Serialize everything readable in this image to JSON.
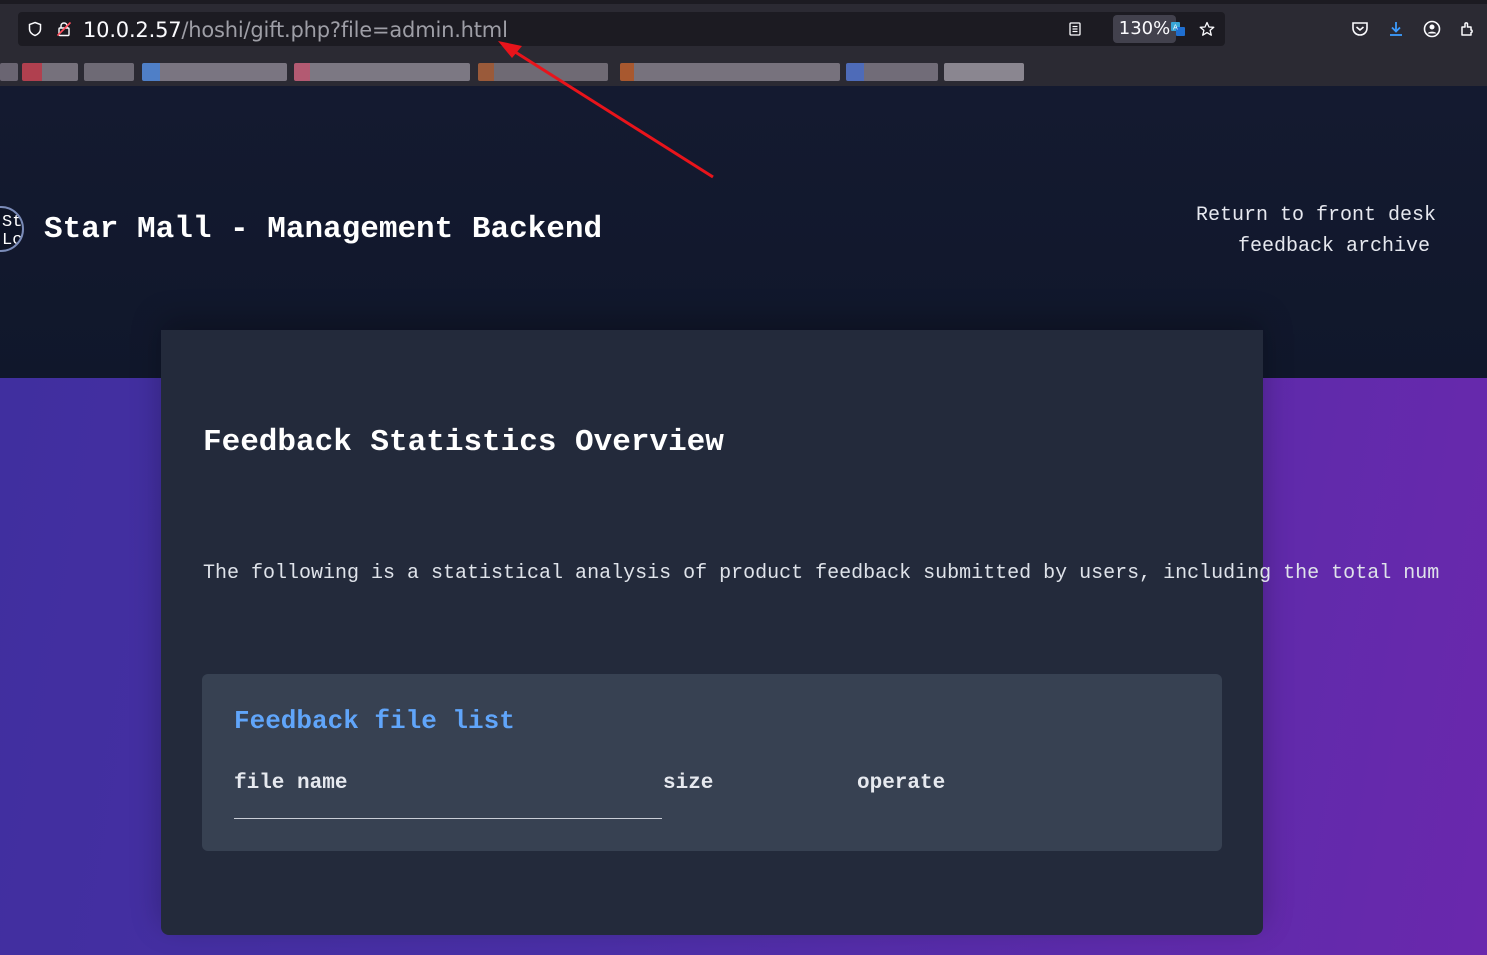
{
  "browser": {
    "url_host": "10.0.2.57",
    "url_path": "/hoshi/gift.php?file=admin.html",
    "zoom": "130%",
    "icons": [
      "shield-icon",
      "lock-warning-icon",
      "reader-view-icon",
      "translate-icon",
      "star-icon",
      "pocket-icon",
      "download-icon",
      "account-icon",
      "extensions-icon"
    ]
  },
  "header": {
    "logo_text": "St\nLc",
    "title": "Star Mall - Management Backend",
    "nav": [
      {
        "label": "Return to front desk"
      },
      {
        "label": "feedback archive"
      }
    ]
  },
  "main": {
    "title": "Feedback Statistics Overview",
    "description": "The following is a statistical analysis of product feedback submitted by users, including the total num",
    "file_list": {
      "title": "Feedback file list",
      "columns": [
        "file name",
        "size",
        "operate"
      ]
    }
  },
  "colors": {
    "accent_blue": "#60a5fa",
    "card_bg": "#232a3b",
    "panel_bg": "#374152",
    "header_bg": "#141a30",
    "annotation_red": "#e8141b"
  }
}
